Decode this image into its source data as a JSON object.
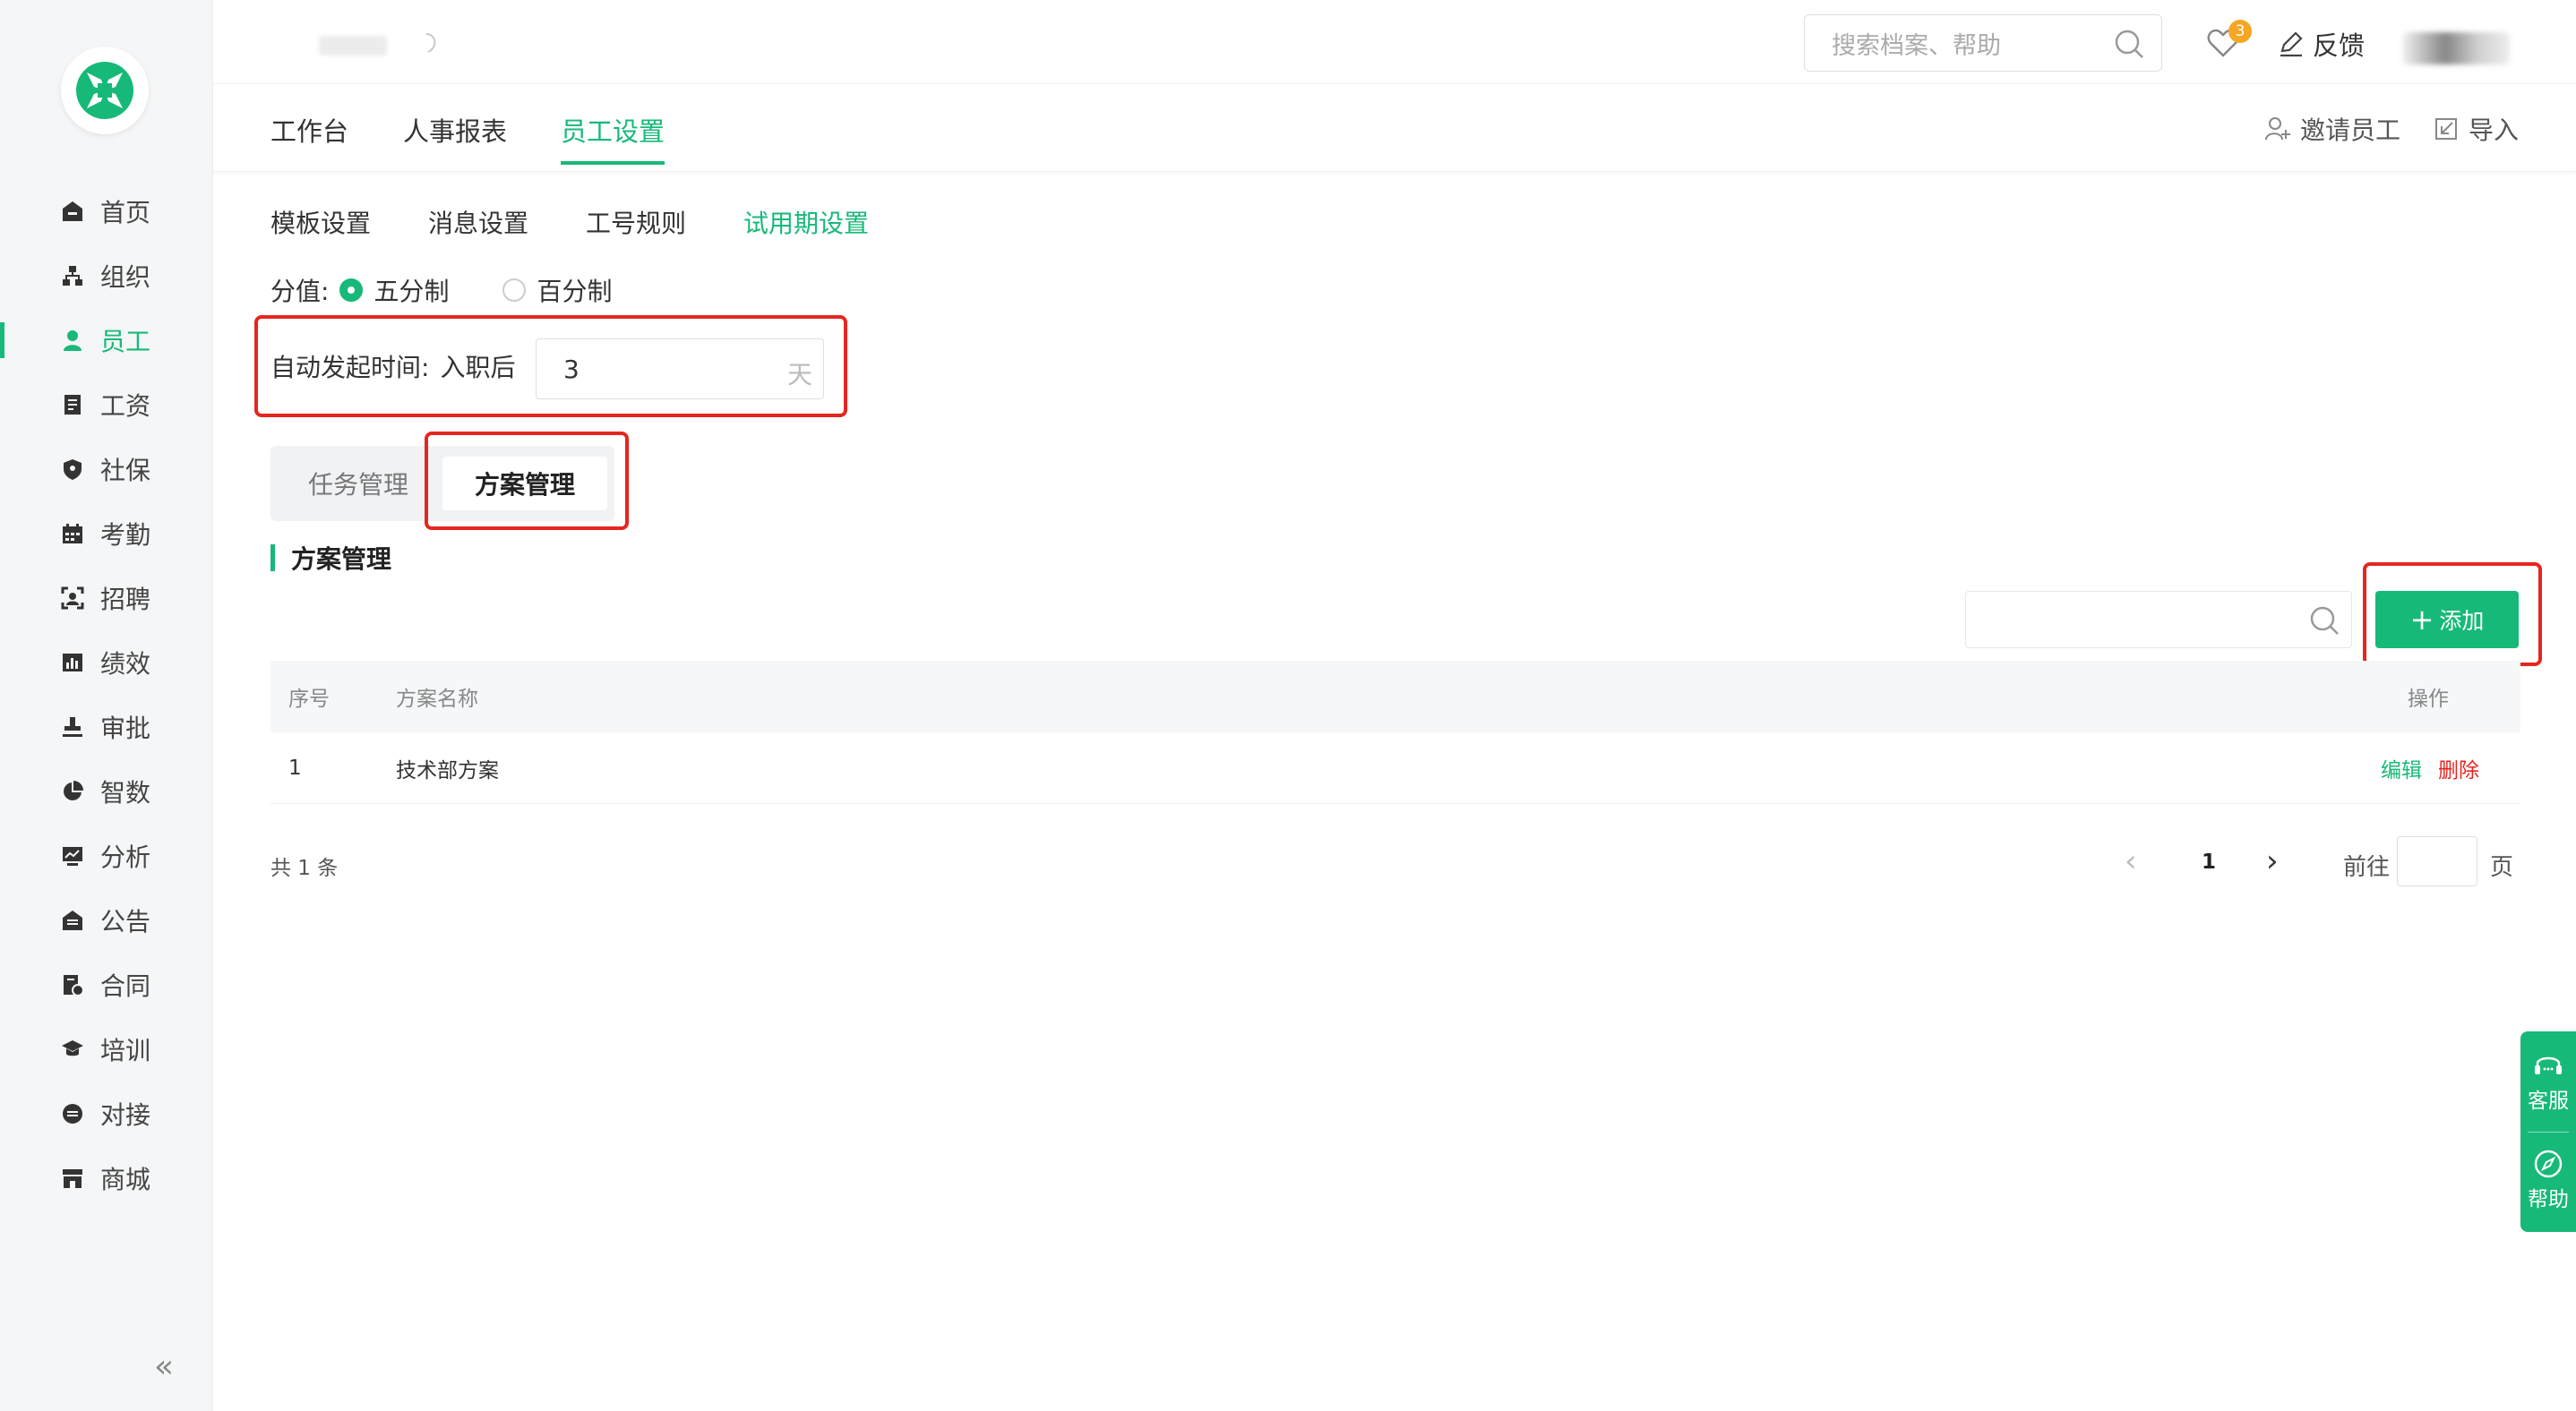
{
  "sidebar": {
    "items": [
      {
        "label": "首页",
        "icon": "home-icon"
      },
      {
        "label": "组织",
        "icon": "org-icon"
      },
      {
        "label": "员工",
        "icon": "user-icon",
        "active": true
      },
      {
        "label": "工资",
        "icon": "salary-icon"
      },
      {
        "label": "社保",
        "icon": "shield-icon"
      },
      {
        "label": "考勤",
        "icon": "calendar-icon"
      },
      {
        "label": "招聘",
        "icon": "recruit-icon"
      },
      {
        "label": "绩效",
        "icon": "bar-chart-icon"
      },
      {
        "label": "审批",
        "icon": "stamp-icon"
      },
      {
        "label": "智数",
        "icon": "pie-chart-icon"
      },
      {
        "label": "分析",
        "icon": "monitor-chart-icon"
      },
      {
        "label": "公告",
        "icon": "announcement-icon"
      },
      {
        "label": "合同",
        "icon": "contract-icon"
      },
      {
        "label": "培训",
        "icon": "graduation-cap-icon"
      },
      {
        "label": "对接",
        "icon": "link-icon"
      },
      {
        "label": "商城",
        "icon": "store-icon"
      }
    ],
    "collapse_label": "«"
  },
  "topbar": {
    "search_placeholder": "搜索档案、帮助",
    "notification_count": "3",
    "feedback_label": "反馈"
  },
  "main_tabs": [
    "工作台",
    "人事报表",
    "员工设置"
  ],
  "main_actions": {
    "invite": "邀请员工",
    "import": "导入"
  },
  "sub_tabs": [
    "模板设置",
    "消息设置",
    "工号规则",
    "试用期设置"
  ],
  "score": {
    "label": "分值:",
    "option_five": "五分制",
    "option_hundred": "百分制"
  },
  "auto_start": {
    "label": "自动发起时间:",
    "after": "入职后",
    "value": "3",
    "unit": "天"
  },
  "segments": {
    "task": "任务管理",
    "plan": "方案管理"
  },
  "section_title": "方案管理",
  "add_button": "添加",
  "table": {
    "headers": {
      "idx": "序号",
      "name": "方案名称",
      "op": "操作"
    },
    "rows": [
      {
        "idx": "1",
        "name": "技术部方案",
        "edit": "编辑",
        "delete": "删除"
      }
    ]
  },
  "pagination": {
    "total": "共 1 条",
    "page": "1",
    "goto": "前往",
    "page_unit": "页"
  },
  "float_panel": {
    "service": "客服",
    "help": "帮助"
  },
  "colors": {
    "accent": "#17b978",
    "danger": "#e5261f",
    "badge": "#f5a623"
  }
}
